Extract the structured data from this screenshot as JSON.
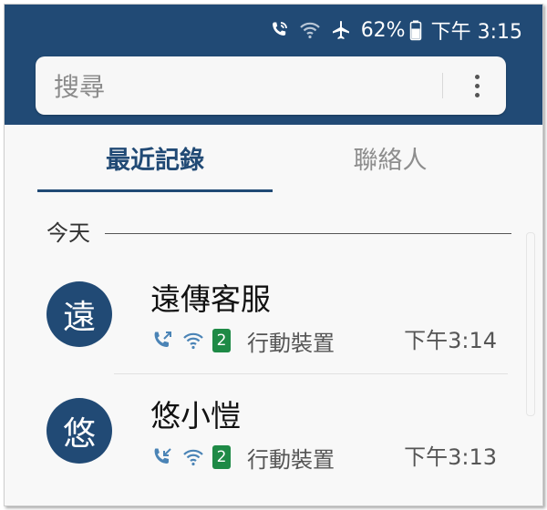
{
  "status_bar": {
    "battery_percent": "62%",
    "time": "下午 3:15",
    "icons": [
      "wifi-calling-icon",
      "wifi-icon",
      "airplane-mode-icon",
      "battery-icon"
    ]
  },
  "search": {
    "placeholder": "搜尋",
    "menu_icon": "more-vert-icon"
  },
  "tabs": [
    {
      "label": "最近記錄",
      "active": true
    },
    {
      "label": "聯絡人",
      "active": false
    }
  ],
  "section": {
    "label": "今天"
  },
  "calls": [
    {
      "avatar": "遠",
      "name": "遠傳客服",
      "direction": "outgoing",
      "sim": "2",
      "device": "行動裝置",
      "time": "下午3:14"
    },
    {
      "avatar": "悠",
      "name": "悠小愷",
      "direction": "incoming",
      "sim": "2",
      "device": "行動裝置",
      "time": "下午3:13"
    }
  ],
  "colors": {
    "header": "#214a75",
    "accent": "#214a75",
    "call_icon": "#4b84b6",
    "sim_badge": "#1e8a46"
  }
}
